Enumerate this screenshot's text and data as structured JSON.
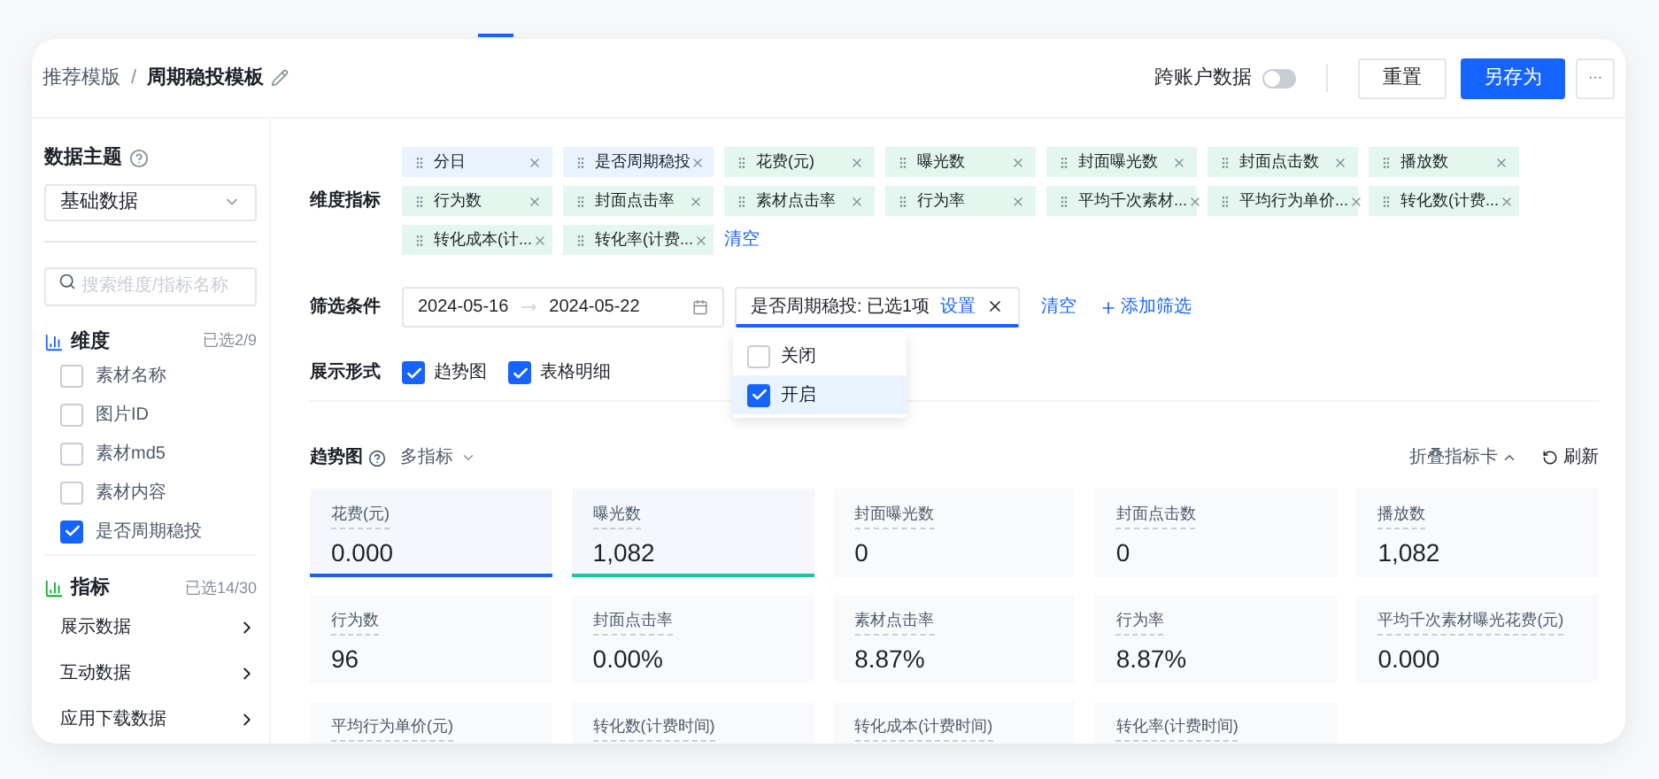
{
  "breadcrumb": {
    "parent": "推荐模版",
    "separator": "/",
    "current": "周期稳投模板"
  },
  "header": {
    "cross_account": {
      "label": "跨账户数据",
      "on": false
    },
    "reset": "重置",
    "save_as": "另存为",
    "more": "···"
  },
  "sidebar": {
    "topic_label": "数据主题",
    "topic_select": "基础数据",
    "search": {
      "placeholder": "搜索维度/指标名称"
    },
    "dimension_group": {
      "title": "维度",
      "count": "已选2/9",
      "items": [
        {
          "label": "素材名称",
          "checked": false
        },
        {
          "label": "图片ID",
          "checked": false
        },
        {
          "label": "素材md5",
          "checked": false
        },
        {
          "label": "素材内容",
          "checked": false
        },
        {
          "label": "是否周期稳投",
          "checked": true
        }
      ]
    },
    "metric_group": {
      "title": "指标",
      "count": "已选14/30",
      "items": [
        "展示数据",
        "互动数据",
        "应用下载数据"
      ]
    }
  },
  "dimension_metrics": {
    "label": "维度指标",
    "tags": [
      {
        "label": "分日",
        "kind": "dimension"
      },
      {
        "label": "是否周期稳投",
        "kind": "dimension"
      },
      {
        "label": "花费(元)",
        "kind": "metric"
      },
      {
        "label": "曝光数",
        "kind": "metric"
      },
      {
        "label": "封面曝光数",
        "kind": "metric"
      },
      {
        "label": "封面点击数",
        "kind": "metric"
      },
      {
        "label": "播放数",
        "kind": "metric"
      },
      {
        "label": "行为数",
        "kind": "metric"
      },
      {
        "label": "封面点击率",
        "kind": "metric"
      },
      {
        "label": "素材点击率",
        "kind": "metric"
      },
      {
        "label": "行为率",
        "kind": "metric"
      },
      {
        "label": "平均千次素材...",
        "kind": "metric"
      },
      {
        "label": "平均行为单价...",
        "kind": "metric"
      },
      {
        "label": "转化数(计费...",
        "kind": "metric"
      },
      {
        "label": "转化成本(计...",
        "kind": "metric"
      },
      {
        "label": "转化率(计费...",
        "kind": "metric"
      }
    ],
    "clear": "清空"
  },
  "filter": {
    "label": "筛选条件",
    "date_start": "2024-05-16",
    "date_end": "2024-05-22",
    "chip": {
      "text": "是否周期稳投: 已选1项",
      "action": "设置"
    },
    "clear": "清空",
    "add": "添加筛选",
    "dropdown": [
      {
        "label": "关闭",
        "checked": false
      },
      {
        "label": "开启",
        "checked": true
      }
    ]
  },
  "display": {
    "label": "展示形式",
    "options": [
      {
        "label": "趋势图",
        "checked": true
      },
      {
        "label": "表格明细",
        "checked": true
      }
    ]
  },
  "trend": {
    "title": "趋势图",
    "mode": "多指标",
    "collapse": "折叠指标卡",
    "refresh": "刷新",
    "cards": [
      {
        "label": "花费(元)",
        "value": "0.000",
        "selected": true,
        "color": "#1664ff"
      },
      {
        "label": "曝光数",
        "value": "1,082",
        "selected": true,
        "color": "#14c9a0"
      },
      {
        "label": "封面曝光数",
        "value": "0",
        "selected": false
      },
      {
        "label": "封面点击数",
        "value": "0",
        "selected": false
      },
      {
        "label": "播放数",
        "value": "1,082",
        "selected": false
      },
      {
        "label": "行为数",
        "value": "96",
        "selected": false
      },
      {
        "label": "封面点击率",
        "value": "0.00%",
        "selected": false
      },
      {
        "label": "素材点击率",
        "value": "8.87%",
        "selected": false
      },
      {
        "label": "行为率",
        "value": "8.87%",
        "selected": false
      },
      {
        "label": "平均千次素材曝光花费(元)",
        "value": "0.000",
        "selected": false
      },
      {
        "label": "平均行为单价(元)"
      },
      {
        "label": "转化数(计费时间)"
      },
      {
        "label": "转化成本(计费时间)"
      },
      {
        "label": "转化率(计费时间)"
      }
    ]
  }
}
